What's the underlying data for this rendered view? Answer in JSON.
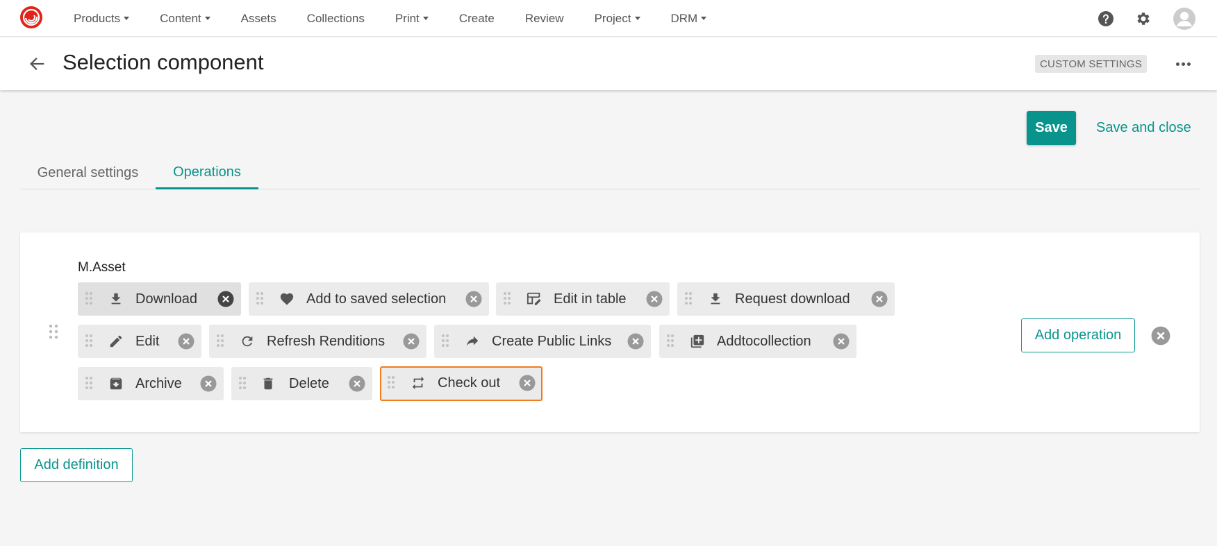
{
  "nav": {
    "items": [
      {
        "label": "Products",
        "dropdown": true
      },
      {
        "label": "Content",
        "dropdown": true
      },
      {
        "label": "Assets",
        "dropdown": false
      },
      {
        "label": "Collections",
        "dropdown": false
      },
      {
        "label": "Print",
        "dropdown": true
      },
      {
        "label": "Create",
        "dropdown": false
      },
      {
        "label": "Review",
        "dropdown": false
      },
      {
        "label": "Project",
        "dropdown": true
      },
      {
        "label": "DRM",
        "dropdown": true
      }
    ],
    "right_icons": [
      "help-icon",
      "gear-icon",
      "avatar-icon"
    ]
  },
  "header": {
    "title": "Selection component",
    "badge": "CUSTOM SETTINGS"
  },
  "actions": {
    "save_label": "Save",
    "save_close_label": "Save and close"
  },
  "tabs": [
    {
      "label": "General settings",
      "active": false
    },
    {
      "label": "Operations",
      "active": true
    }
  ],
  "definition": {
    "entity": "M.Asset",
    "operations": [
      {
        "label": "Download",
        "icon": "download-icon"
      },
      {
        "label": "Add to saved selection",
        "icon": "heart-icon"
      },
      {
        "label": "Edit in table",
        "icon": "edit-table-icon"
      },
      {
        "label": "Request download",
        "icon": "download-icon"
      },
      {
        "label": "Edit",
        "icon": "pencil-icon"
      },
      {
        "label": "Refresh Renditions",
        "icon": "refresh-icon"
      },
      {
        "label": "Create Public Links",
        "icon": "share-arrow-icon"
      },
      {
        "label": "Addtocollection",
        "icon": "collection-add-icon"
      },
      {
        "label": "Archive",
        "icon": "archive-icon"
      },
      {
        "label": "Delete",
        "icon": "trash-icon"
      },
      {
        "label": "Check out",
        "icon": "swap-icon"
      }
    ],
    "add_operation_label": "Add operation"
  },
  "add_definition_label": "Add definition",
  "colors": {
    "accent": "#08948c",
    "focus_outline": "#f07c1e",
    "logo_red": "#e2231a"
  }
}
